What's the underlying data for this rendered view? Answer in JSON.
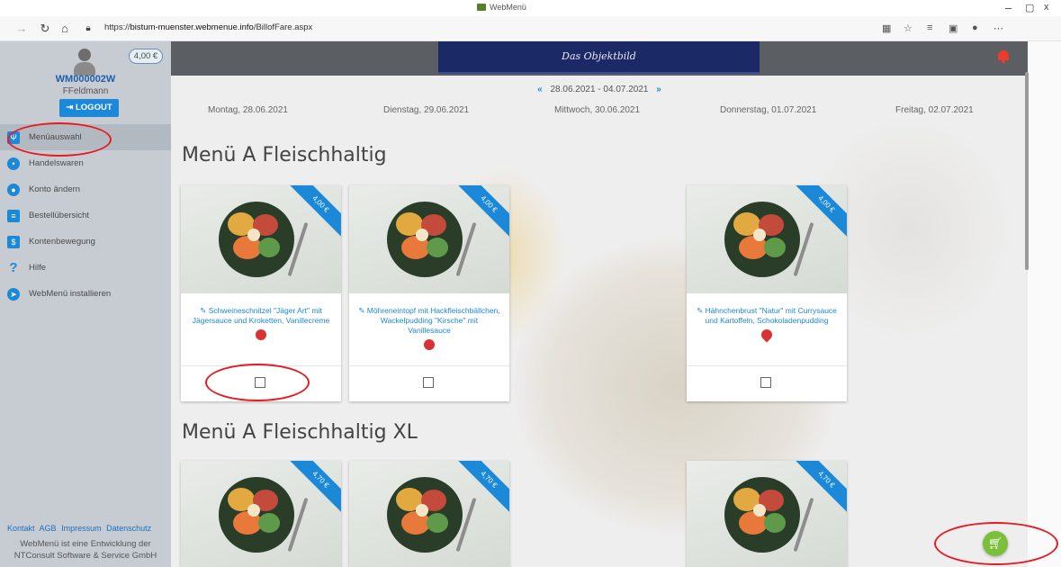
{
  "browser": {
    "window_title": "WebMenü",
    "url_prefix": "https://",
    "url_host": "bistum-muenster.webmenue.info",
    "url_path": "/BillofFare.aspx",
    "controls": {
      "minimize": "–",
      "maximize": "▢",
      "close": "x"
    }
  },
  "user": {
    "balance": "4,00 €",
    "id": "WM000002W",
    "name": "FFeldmann",
    "logout": "LOGOUT"
  },
  "menu": [
    {
      "label": "Menüauswahl",
      "icon": "fork-knife-icon",
      "active": true
    },
    {
      "label": "Handelswaren",
      "icon": "cookie-icon"
    },
    {
      "label": "Konto ändern",
      "icon": "user-icon"
    },
    {
      "label": "Bestellübersicht",
      "icon": "document-icon"
    },
    {
      "label": "Kontenbewegung",
      "icon": "account-movement-icon"
    },
    {
      "label": "Hilfe",
      "icon": "help-icon"
    },
    {
      "label": "WebMenü installieren",
      "icon": "rocket-icon"
    }
  ],
  "footer": {
    "links": [
      "Kontakt",
      "AGB",
      "Impressum",
      "Datenschutz"
    ],
    "line1": "WebMenü ist eine Entwicklung der",
    "line2": "NTConsult Software & Service GmbH"
  },
  "header": {
    "banner": "Das Objektbild"
  },
  "week": {
    "range": "28.06.2021 - 04.07.2021",
    "prev": "«",
    "next": "»"
  },
  "days": [
    "Montag, 28.06.2021",
    "Dienstag, 29.06.2021",
    "Mittwoch, 30.06.2021",
    "Donnerstag, 01.07.2021",
    "Freitag, 02.07.2021"
  ],
  "sections": [
    {
      "title": "Menü A Fleischhaltig",
      "items": [
        {
          "price": "4,00 €",
          "desc": "Schweineschnitzel \"Jäger Art\" mit Jägersauce und Kroketten, Vanillecreme"
        },
        {
          "price": "4,00 €",
          "desc": "Möhreneintopf mit Hackfleischbällchen, Wackelpudding \"Kirsche\" mit Vanillesauce"
        },
        {
          "price": "4,00 €",
          "desc": "Hähnchenbrust \"Natur\" mit Currysauce und Kartoffeln, Schokoladenpudding"
        }
      ]
    },
    {
      "title": "Menü A Fleischhaltig XL",
      "items": [
        {
          "price": "4,70 €"
        },
        {
          "price": "4,70 €"
        },
        {
          "price": "4,70 €"
        }
      ]
    }
  ],
  "colors": {
    "accent": "#1b88d8",
    "sidebar": "#c7ccd3",
    "header": "#5b5e63",
    "banner": "#1b2a66",
    "cart": "#7cbf3a",
    "annotation": "#e51c24"
  }
}
